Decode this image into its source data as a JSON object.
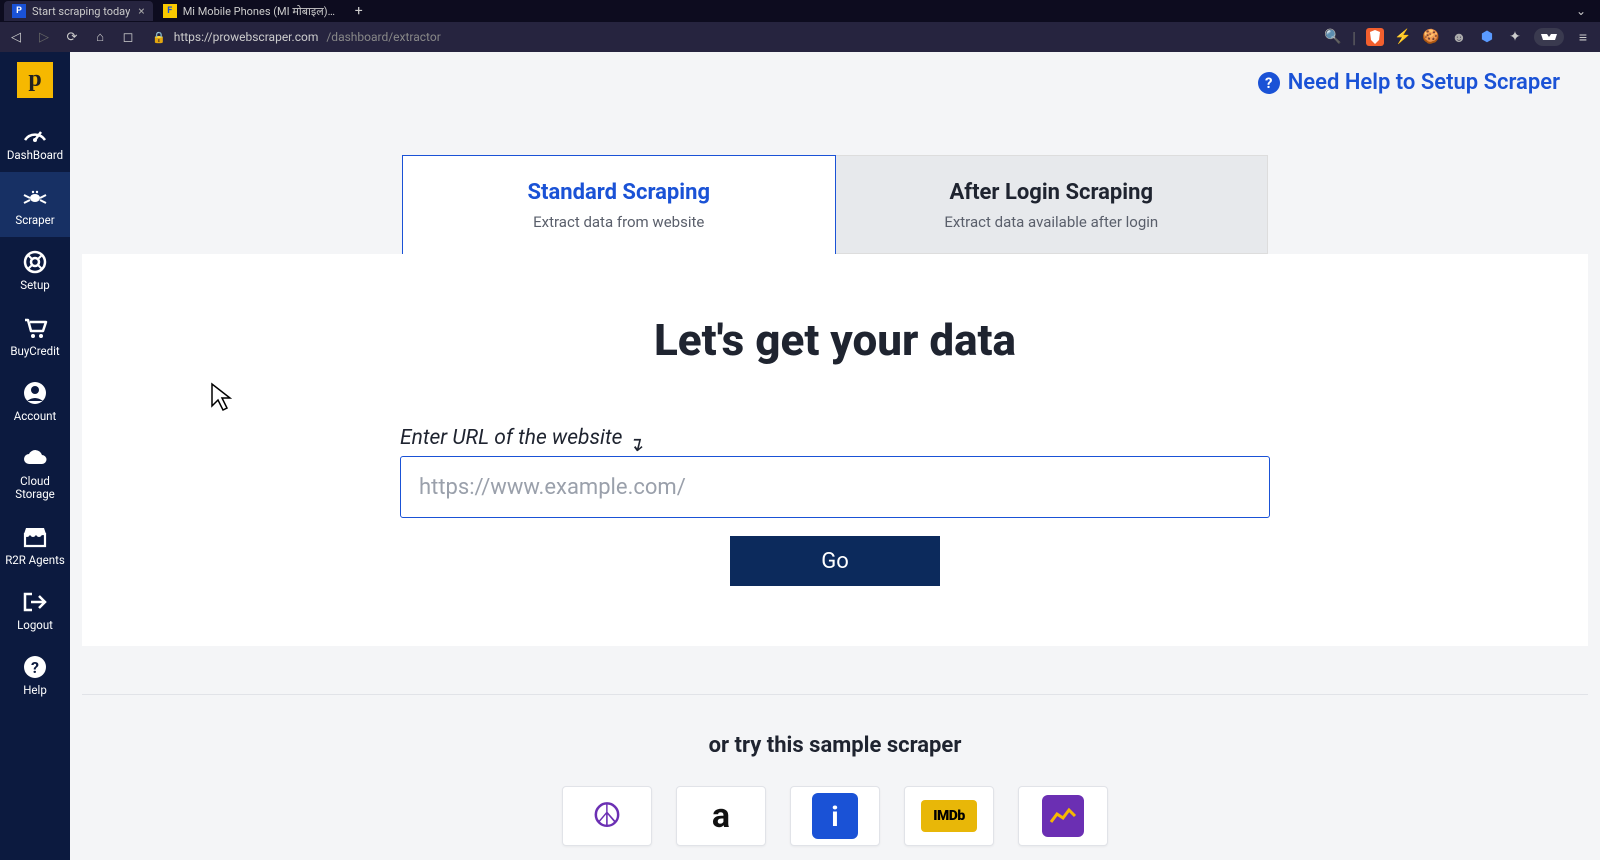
{
  "browser": {
    "tabs": [
      {
        "title": "Start scraping today",
        "active": true
      },
      {
        "title": "Mi Mobile Phones (MI मोबाइल) and",
        "active": false
      }
    ],
    "url_host": "https://prowebscraper.com",
    "url_path": "/dashboard/extractor"
  },
  "sidebar": {
    "items": [
      {
        "id": "dashboard",
        "label": "DashBoard"
      },
      {
        "id": "scraper",
        "label": "Scraper"
      },
      {
        "id": "setup",
        "label": "Setup"
      },
      {
        "id": "buycredit",
        "label": "BuyCredit"
      },
      {
        "id": "account",
        "label": "Account"
      },
      {
        "id": "cloudstorage",
        "label": "Cloud Storage"
      },
      {
        "id": "r2ragents",
        "label": "R2R Agents"
      },
      {
        "id": "logout",
        "label": "Logout"
      },
      {
        "id": "help",
        "label": "Help"
      }
    ]
  },
  "header": {
    "help_link": "Need Help to Setup Scraper"
  },
  "modes": {
    "standard": {
      "title": "Standard Scraping",
      "sub": "Extract data from website"
    },
    "afterlogin": {
      "title": "After Login Scraping",
      "sub": "Extract data available after login"
    }
  },
  "main": {
    "headline": "Let's get your data",
    "field_label": "Enter URL of the website",
    "placeholder": "https://www.example.com/",
    "go_label": "Go"
  },
  "samples": {
    "heading": "or try this sample scraper",
    "items": [
      {
        "id": "craigslist"
      },
      {
        "id": "amazon"
      },
      {
        "id": "indeed"
      },
      {
        "id": "imdb"
      },
      {
        "id": "yahoo-finance"
      }
    ]
  }
}
